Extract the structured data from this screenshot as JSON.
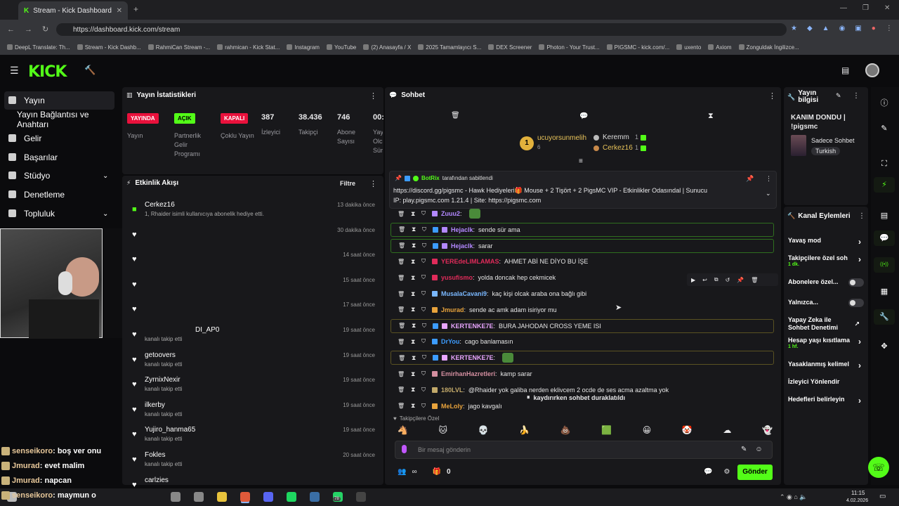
{
  "browser": {
    "tab_title": "Stream - Kick Dashboard",
    "url": "https://dashboard.kick.com/stream",
    "bookmarks": [
      "DeepL Translate: Th...",
      "Stream - Kick Dashb...",
      "RahmiCan Stream -...",
      "rahmican - Kick Stat...",
      "Instagram",
      "YouTube",
      "(2) Anasayfa / X",
      "2025 Tamamlayıcı S...",
      "DEX Screener",
      "Photon - Your Trust...",
      "PIGSMC - kick.com/...",
      "uxento",
      "Axiom",
      "Zonguldak İngilizce..."
    ]
  },
  "logo": "KICK",
  "nav": {
    "items": [
      {
        "label": "Yayın",
        "icon": "broadcast-icon"
      },
      {
        "label": "Yayın Bağlantısı ve Anahtarı",
        "icon": ""
      },
      {
        "label": "Gelir",
        "icon": "money-icon"
      },
      {
        "label": "Başarılar",
        "icon": "trophy-icon"
      },
      {
        "label": "Stüdyo",
        "icon": "studio-icon"
      },
      {
        "label": "Denetleme",
        "icon": "hammer-icon"
      },
      {
        "label": "Topluluk",
        "icon": "people-icon"
      }
    ]
  },
  "stats": {
    "title": "Yayın İstatistikleri",
    "badges": [
      {
        "badge": "YAYINDA",
        "label": "Yayın",
        "color": "#e9113c"
      },
      {
        "badge": "AÇIK",
        "label": "Partnerlik Gelir Programı",
        "color": "#53fc18"
      },
      {
        "badge": "KAPALI",
        "label": "Çoklu Yayın",
        "color": "#e9113c"
      }
    ],
    "numbers": [
      {
        "value": "387",
        "label": "İzleyici"
      },
      {
        "value": "38.436",
        "label": "Takipçi"
      },
      {
        "value": "746",
        "label": "Abone Sayısı"
      },
      {
        "value": "00:",
        "label": "Yay Olc Sür"
      }
    ]
  },
  "activity": {
    "title": "Etkinlik Akışı",
    "filter": "Filtre",
    "items": [
      {
        "name": "Cerkez16",
        "sub": "1, Rhaider isimli kullanıcıya abonelik hediye etti.",
        "time": "13 dakika önce"
      },
      {
        "name": "",
        "sub": "",
        "time": "30 dakika önce"
      },
      {
        "name": "",
        "sub": "",
        "time": "14 saat önce"
      },
      {
        "name": "",
        "sub": "",
        "time": "15 saat önce"
      },
      {
        "name": "",
        "sub": "",
        "time": "17 saat önce"
      },
      {
        "name": "DI_AP0",
        "sub": "kanalı takip etti",
        "time": "19 saat önce"
      },
      {
        "name": "getoovers",
        "sub": "kanalı takip etti",
        "time": "19 saat önce"
      },
      {
        "name": "ZyrnixNexir",
        "sub": "kanalı takip etti",
        "time": "19 saat önce"
      },
      {
        "name": "ilkerby",
        "sub": "kanalı takip etti",
        "time": "19 saat önce"
      },
      {
        "name": "Yujiro_hanma65",
        "sub": "kanalı takip etti",
        "time": "19 saat önce"
      },
      {
        "name": "Fokles",
        "sub": "kanalı takip etti",
        "time": "20 saat önce"
      },
      {
        "name": "carlzies",
        "sub": "",
        "time": ""
      }
    ]
  },
  "overlay_chat": [
    {
      "user": "senseikoro",
      "text": ": boş ver onu"
    },
    {
      "user": "Jmurad",
      "text": ": evet malim"
    },
    {
      "user": "Jmurad",
      "text": ": napcan"
    },
    {
      "user": "senseikoro",
      "text": ": maymun o"
    }
  ],
  "chat": {
    "title": "Sohbet",
    "leaders": [
      {
        "name": "ucuyorsunmelih",
        "count": "6"
      },
      {
        "name": "Keremm",
        "count": "1"
      },
      {
        "name": "Cerkez16",
        "count": "1"
      }
    ],
    "pinned": {
      "by": "BotRix",
      "label": "tarafından sabitlendi",
      "text1": "https://discord.gg/pigsmc - Hawk Hediyeleri🎁 Mouse + 2 Tişört + 2 PigsMC VIP - Etkinlikler Odasındal | Sunucu",
      "text2": "IP: play.pigsmc.com 1.21.4 | Site: https://pigsmc.com"
    },
    "messages": [
      {
        "user": "Zuuu2",
        "text": "",
        "color": "#b388ff",
        "hl": ""
      },
      {
        "user": "Hejaclk",
        "text": "sende sür ama",
        "color": "#b388ff",
        "hl": "g"
      },
      {
        "user": "Hejaclk",
        "text": "sarar",
        "color": "#b388ff",
        "hl": "g"
      },
      {
        "user": "YEREdeLIMLAMAS",
        "text": "AHMET ABİ NE DİYO BU İŞE",
        "color": "#e02b5a",
        "hl": ""
      },
      {
        "user": "yusufismo",
        "text": "yolda doncak hep cekmicek",
        "color": "#e02b5a",
        "hl": ""
      },
      {
        "user": "MusalaCavani9",
        "text": "kaç kişi olcak araba ona bağlı gibi",
        "color": "#7ab8ff",
        "hl": ""
      },
      {
        "user": "Jmurad",
        "text": "sende ac amk adam isiriyor mu",
        "color": "#e8a33c",
        "hl": ""
      },
      {
        "user": "KERTENKE7E",
        "text": "BURA JAHODAN CROSS YEME ISI",
        "color": "#e9a6ff",
        "hl": "y"
      },
      {
        "user": "DrYou",
        "text": "cago banlamasın",
        "color": "#3c9cff",
        "hl": ""
      },
      {
        "user": "KERTENKE7E",
        "text": "",
        "color": "#e9a6ff",
        "hl": "y"
      },
      {
        "user": "EmirhanHazretleri",
        "text": "kamp sarar",
        "color": "#d48fa0",
        "hl": ""
      },
      {
        "user": "180LVL",
        "text": "@Rhaider yok galiba nerden eklivcem 2 ocde de ses acma azaltma yok",
        "color": "#c2a96a",
        "hl": ""
      },
      {
        "user": "MeLoly",
        "text": "jago kavgalı",
        "color": "#e8a33c",
        "hl": ""
      }
    ],
    "paused": "kaydırırken sohbet duraklatıldı",
    "followers_only": "Takipçilere Özel",
    "placeholder": "Bir mesaj gönderin",
    "send": "Gönder",
    "count": "0"
  },
  "info": {
    "title": "Yayın bilgisi",
    "stream_title": "KANIM DONDU | !pigsmc",
    "category": "Sadece Sohbet",
    "language": "Turkish"
  },
  "actions": {
    "title": "Kanal Eylemleri",
    "items": [
      {
        "label": "Yavaş mod",
        "sub": "",
        "type": "arrow"
      },
      {
        "label": "Takipçilere özel soh",
        "sub": "1 dk.",
        "type": "arrow"
      },
      {
        "label": "Abonelere özel...",
        "sub": "",
        "type": "toggle"
      },
      {
        "label": "Yalnızca...",
        "sub": "",
        "type": "toggle"
      },
      {
        "label": "Yapay Zeka ile Sohbet Denetimi",
        "sub": "",
        "type": "ext"
      },
      {
        "label": "Hesap yaşı kısıtlama",
        "sub": "1 hf.",
        "type": "arrow"
      },
      {
        "label": "Yasaklanmış kelimel",
        "sub": "",
        "type": "arrow"
      },
      {
        "label": "İzleyici Yönlendir",
        "sub": "",
        "type": ""
      },
      {
        "label": "Hedefleri belirleyin",
        "sub": "",
        "type": "arrow"
      }
    ]
  },
  "taskbar": {
    "time": "11:15",
    "date": "4.02.2026",
    "badge": "78"
  },
  "colors": {
    "accent": "#53fc18",
    "live": "#e9113c"
  }
}
